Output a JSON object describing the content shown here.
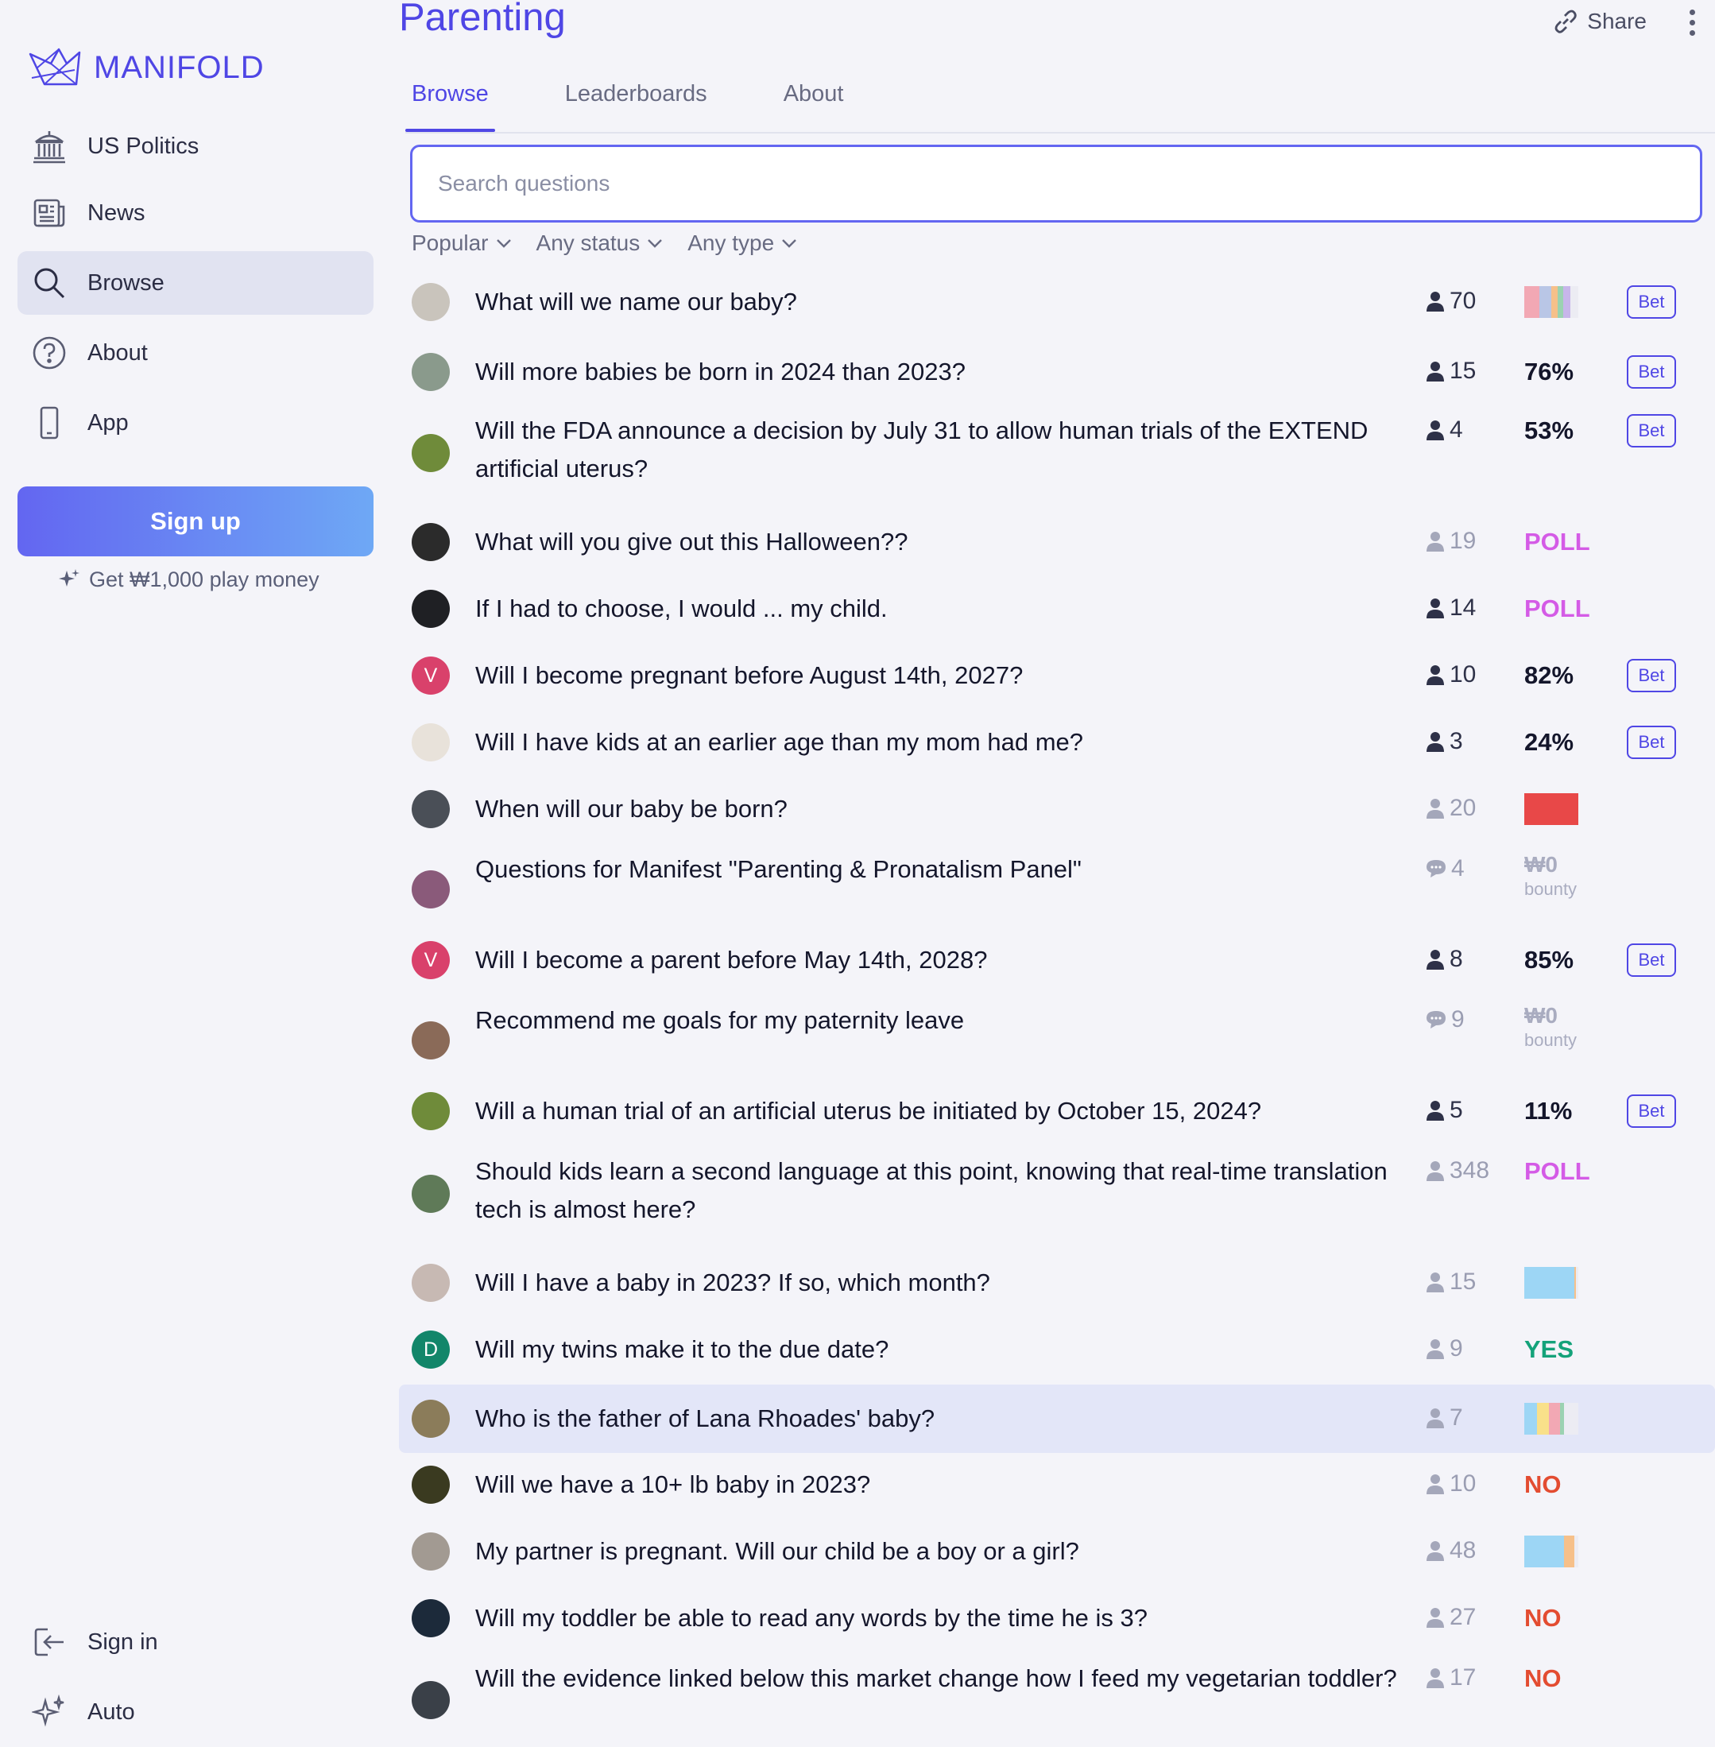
{
  "brand": {
    "name": "MANIFOLD"
  },
  "sidebar": {
    "items": [
      {
        "label": "US Politics",
        "icon": "capitol-icon"
      },
      {
        "label": "News",
        "icon": "newspaper-icon"
      },
      {
        "label": "Browse",
        "icon": "search-icon"
      },
      {
        "label": "About",
        "icon": "question-circle-icon"
      },
      {
        "label": "App",
        "icon": "phone-icon"
      }
    ],
    "signup_label": "Sign up",
    "promo": "Get ₩1,000 play money",
    "bottom_items": [
      {
        "label": "Sign in",
        "icon": "sign-in-icon"
      },
      {
        "label": "Auto",
        "icon": "sparkles-icon"
      }
    ]
  },
  "header": {
    "title": "Parenting",
    "share_label": "Share",
    "tabs": [
      "Browse",
      "Leaderboards",
      "About"
    ],
    "active_tab": "Browse"
  },
  "search": {
    "placeholder": "Search questions",
    "value": ""
  },
  "filters": [
    "Popular",
    "Any status",
    "Any type"
  ],
  "colors": {
    "accent": "#4f46e5",
    "poll": "#d45be6",
    "yes": "#14a27a",
    "no": "#e34c31"
  },
  "questions": [
    {
      "title": "What will we name our baby?",
      "stat_type": "traders",
      "count": "70",
      "muted": false,
      "result_type": "bar",
      "bet": true
    },
    {
      "title": "Will more babies be born in 2024 than 2023?",
      "stat_type": "traders",
      "count": "15",
      "muted": false,
      "result_type": "prob",
      "result": "76%",
      "bet": true
    },
    {
      "title": "Will the FDA announce a decision by July 31 to allow human trials of the EXTEND artificial uterus?",
      "stat_type": "traders",
      "count": "4",
      "muted": false,
      "result_type": "prob",
      "result": "53%",
      "bet": true
    },
    {
      "title": "What will you give out this Halloween??",
      "stat_type": "traders",
      "count": "19",
      "muted": true,
      "result_type": "poll",
      "result": "POLL",
      "bet": false
    },
    {
      "title": "If I had to choose, I would ... my child.",
      "stat_type": "traders",
      "count": "14",
      "muted": false,
      "result_type": "poll",
      "result": "POLL",
      "bet": false
    },
    {
      "title": "Will I become pregnant before August 14th, 2027?",
      "stat_type": "traders",
      "count": "10",
      "muted": false,
      "result_type": "prob",
      "result": "82%",
      "bet": true,
      "avatar_letter": "V"
    },
    {
      "title": "Will I have kids at an earlier age than my mom had me?",
      "stat_type": "traders",
      "count": "3",
      "muted": false,
      "result_type": "prob",
      "result": "24%",
      "bet": true
    },
    {
      "title": "When will our baby be born?",
      "stat_type": "traders",
      "count": "20",
      "muted": true,
      "result_type": "bar",
      "bet": false
    },
    {
      "title": "Questions for Manifest \"Parenting & Pronatalism Panel\"",
      "stat_type": "comments",
      "count": "4",
      "muted": true,
      "result_type": "bounty",
      "result": "₩0",
      "result_label": "bounty",
      "bet": false
    },
    {
      "title": "Will I become a parent before May 14th, 2028?",
      "stat_type": "traders",
      "count": "8",
      "muted": false,
      "result_type": "prob",
      "result": "85%",
      "bet": true,
      "avatar_letter": "V"
    },
    {
      "title": "Recommend me goals for my paternity leave",
      "stat_type": "comments",
      "count": "9",
      "muted": true,
      "result_type": "bounty",
      "result": "₩0",
      "result_label": "bounty",
      "bet": false
    },
    {
      "title": "Will a human trial of an artificial uterus be initiated by October 15, 2024?",
      "stat_type": "traders",
      "count": "5",
      "muted": false,
      "result_type": "prob",
      "result": "11%",
      "bet": true
    },
    {
      "title": "Should kids learn a second language at this point, knowing that real-time translation tech is almost here?",
      "stat_type": "traders",
      "count": "348",
      "muted": true,
      "result_type": "poll",
      "result": "POLL",
      "bet": false
    },
    {
      "title": "Will I have a baby in 2023? If so, which month?",
      "stat_type": "traders",
      "count": "15",
      "muted": true,
      "result_type": "bar",
      "bet": false
    },
    {
      "title": "Will my twins make it to the due date?",
      "stat_type": "traders",
      "count": "9",
      "muted": true,
      "result_type": "yes",
      "result": "YES",
      "bet": false,
      "avatar_letter": "D"
    },
    {
      "title": "Who is the father of Lana Rhoades' baby?",
      "stat_type": "traders",
      "count": "7",
      "muted": true,
      "result_type": "bar",
      "bet": false
    },
    {
      "title": "Will we have a 10+ lb baby in 2023?",
      "stat_type": "traders",
      "count": "10",
      "muted": true,
      "result_type": "no",
      "result": "NO",
      "bet": false
    },
    {
      "title": "My partner is pregnant. Will our child be a boy or a girl?",
      "stat_type": "traders",
      "count": "48",
      "muted": true,
      "result_type": "bar",
      "bet": false
    },
    {
      "title": "Will my toddler be able to read any words by the time he is 3?",
      "stat_type": "traders",
      "count": "27",
      "muted": true,
      "result_type": "no",
      "result": "NO",
      "bet": false
    },
    {
      "title": "Will the evidence linked below this market change how I feed my vegetarian toddler?",
      "stat_type": "traders",
      "count": "17",
      "muted": true,
      "result_type": "no",
      "result": "NO",
      "bet": false
    }
  ],
  "bet_label": "Bet"
}
